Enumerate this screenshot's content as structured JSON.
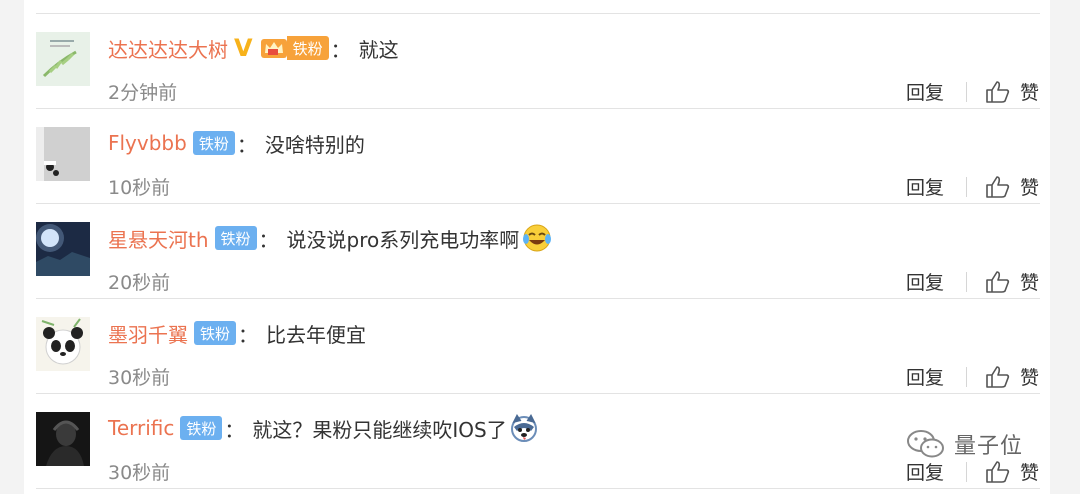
{
  "comments": [
    {
      "username": "达达达达大树",
      "badge": "铁粉",
      "text": "就这",
      "time": "2分钟前",
      "verified": "V",
      "reply": "回复",
      "like": "赞"
    },
    {
      "username": "Flyvbbb",
      "badge": "铁粉",
      "text": "没啥特别的",
      "time": "10秒前",
      "reply": "回复",
      "like": "赞"
    },
    {
      "username": "星悬天河th",
      "badge": "铁粉",
      "text": "说没说pro系列充电功率啊",
      "time": "20秒前",
      "reply": "回复",
      "like": "赞"
    },
    {
      "username": "墨羽千翼",
      "badge": "铁粉",
      "text": "比去年便宜",
      "time": "30秒前",
      "reply": "回复",
      "like": "赞"
    },
    {
      "username": "Terrific",
      "badge": "铁粉",
      "text": "就这？果粉只能继续吹IOS了",
      "time": "30秒前",
      "reply": "回复",
      "like": "赞"
    }
  ],
  "colon": "：",
  "watermark": "量子位",
  "colors": {
    "username": "#eb7350",
    "fan_badge": "#6cb0f0",
    "fan_badge_vip": "#f7a23a",
    "verified": "#f7b21b",
    "time": "#8a8a8a"
  }
}
